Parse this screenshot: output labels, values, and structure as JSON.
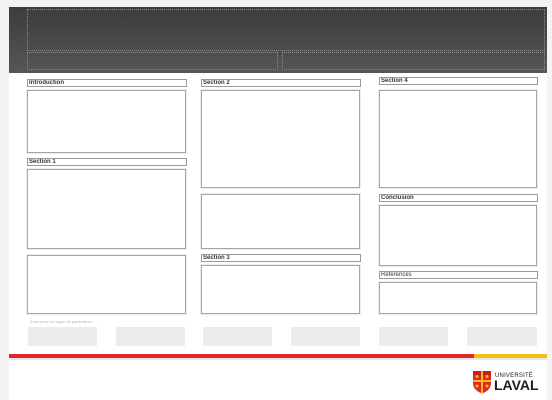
{
  "sections": {
    "introduction": "Introduction",
    "section1": "Section 1",
    "section2": "Section 2",
    "section3": "Section 3",
    "section4": "Section 4",
    "conclusion": "Conclusion",
    "references": "Références"
  },
  "logos_caption": "Zone pour les logos de partenaires",
  "university": {
    "line1": "UNIVERSITÉ",
    "line2": "LAVAL"
  },
  "colors": {
    "header": "#4a4a4a",
    "accent_red": "#e2252b",
    "accent_yellow": "#f6be1a"
  },
  "icons": [
    "universite-laval-logo-icon"
  ]
}
